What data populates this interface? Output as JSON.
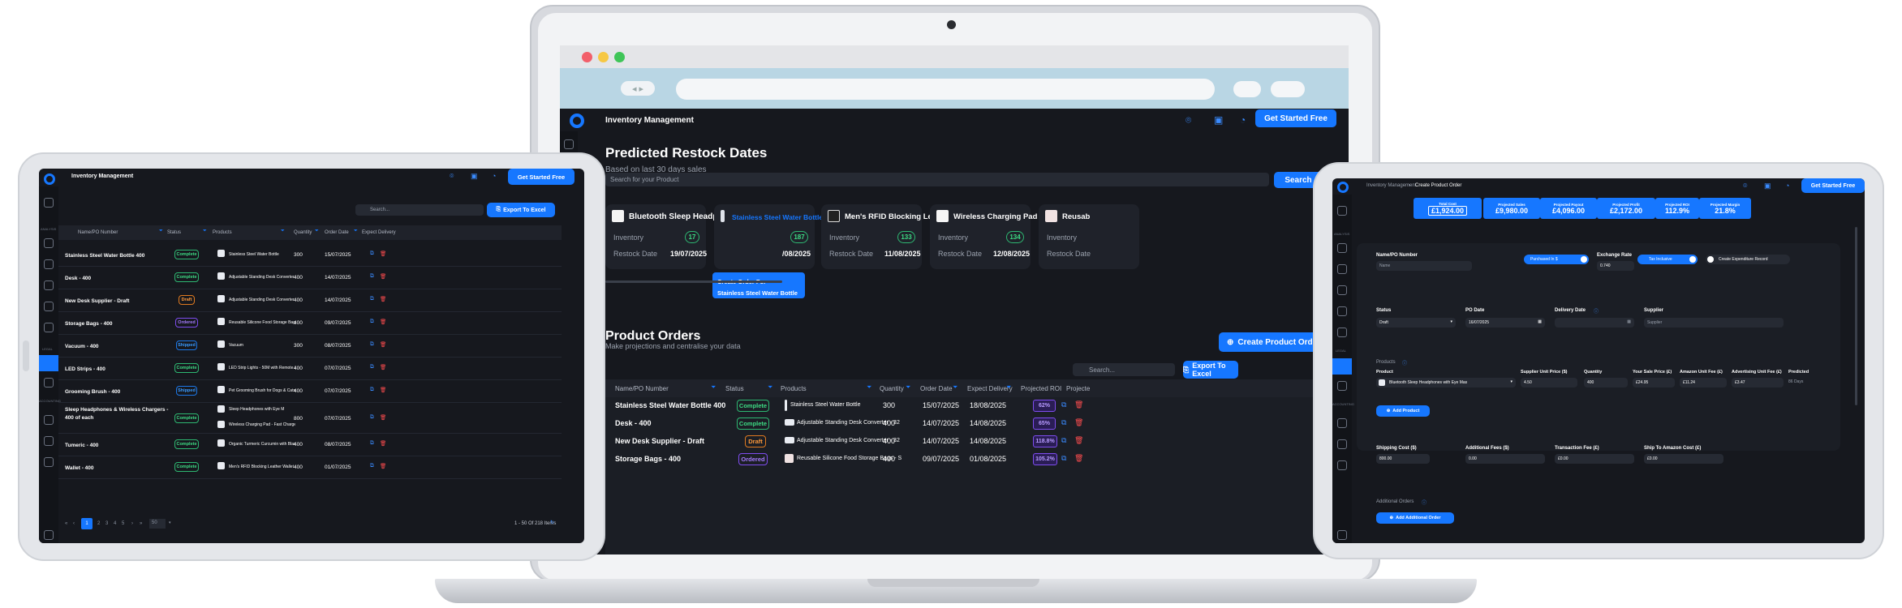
{
  "app_title": "Inventory Management",
  "header_button": "Get Started Free",
  "restock": {
    "title": "Predicted Restock Dates",
    "subtitle": "Based on last 30 days sales",
    "search_placeholder": "Search for your Product",
    "search_button": "Search",
    "inventory_label": "Inventory",
    "restock_label": "Restock Date",
    "cards": [
      {
        "name": "Bluetooth Sleep Headpho...",
        "inventory": "17",
        "date": "19/07/2025"
      },
      {
        "name": "Stainless Steel Water Bottle",
        "inventory": "187",
        "date": "/08/2025"
      },
      {
        "name": "Men's RFID Blocking Leat...",
        "inventory": "133",
        "date": "11/08/2025"
      },
      {
        "name": "Wireless Charging Pad - F...",
        "inventory": "134",
        "date": "12/08/2025"
      },
      {
        "name": "Reusab",
        "inventory": "",
        "date": ""
      }
    ],
    "tooltip_line1": "Create Order For",
    "tooltip_line2": "Stainless Steel Water Bottle"
  },
  "orders": {
    "title": "Product Orders",
    "subtitle": "Make projections and centralise your data",
    "create_button": "Create Product Order",
    "search_placeholder": "Search...",
    "export_button": "Export To Excel",
    "columns": [
      "Name/PO Number",
      "Status",
      "Products",
      "Quantity",
      "Order Date",
      "Expect Delivery",
      "Projected ROI",
      "Projecte"
    ],
    "rows": [
      {
        "name": "Stainless Steel Water Bottle 400",
        "status": "Complete",
        "product": "Stainless Steel Water Bottle",
        "qty": "300",
        "order": "15/07/2025",
        "delivery": "18/08/2025",
        "roi": "62%"
      },
      {
        "name": "Desk - 400",
        "status": "Complete",
        "product": "Adjustable Standing Desk Converter - 32",
        "qty": "400",
        "order": "14/07/2025",
        "delivery": "14/08/2025",
        "roi": "65%"
      },
      {
        "name": "New Desk Supplier - Draft",
        "status": "Draft",
        "product": "Adjustable Standing Desk Converter - 32",
        "qty": "400",
        "order": "14/07/2025",
        "delivery": "14/08/2025",
        "roi": "118.8%"
      },
      {
        "name": "Storage Bags - 400",
        "status": "Ordered",
        "product": "Reusable Silicone Food Storage Bags - S",
        "qty": "400",
        "order": "09/07/2025",
        "delivery": "01/08/2025",
        "roi": "105.2%"
      }
    ]
  },
  "tablet_left": {
    "search_placeholder": "Search...",
    "export_button": "Export To Excel",
    "columns": [
      "Name/PO Number",
      "Status",
      "Products",
      "Quantity",
      "Order Date",
      "Expect Delivery"
    ],
    "rows": [
      {
        "name": "Stainless Steel Water Bottle 400",
        "status": "Complete",
        "product": "Stainless Steel Water Bottle",
        "qty": "300",
        "date": "15/07/2025"
      },
      {
        "name": "Desk - 400",
        "status": "Complete",
        "product": "Adjustable Standing Desk Converter - 32",
        "qty": "400",
        "date": "14/07/2025"
      },
      {
        "name": "New Desk Supplier - Draft",
        "status": "Draft",
        "product": "Adjustable Standing Desk Converter - 32",
        "qty": "400",
        "date": "14/07/2025"
      },
      {
        "name": "Storage Bags - 400",
        "status": "Ordered",
        "product": "Reusable Silicone Food Storage Bags - S",
        "qty": "400",
        "date": "09/07/2025"
      },
      {
        "name": "Vacuum - 400",
        "status": "Shipped",
        "product": "Vacuum",
        "qty": "300",
        "date": "08/07/2025"
      },
      {
        "name": "LED Strips - 400",
        "status": "Complete",
        "product": "LED Strip Lights - 50M with Remote & Ap",
        "qty": "400",
        "date": "07/07/2025"
      },
      {
        "name": "Grooming Brush - 400",
        "status": "Shipped",
        "product": "Pet Grooming Brush for Dogs & Cats - De",
        "qty": "400",
        "date": "07/07/2025"
      },
      {
        "name": "Sleep Headphones & Wireless Chargers - 400 of each",
        "status": "Complete",
        "product": "Sleep Headphones with Eye M",
        "product2": "Wireless Charging Pad - Fast Charge 15V",
        "qty": "800",
        "date": "07/07/2025"
      },
      {
        "name": "Tumeric - 400",
        "status": "Complete",
        "product": "Organic Turmeric Curcumin with Black P",
        "qty": "400",
        "date": "08/07/2025"
      },
      {
        "name": "Wallet - 400",
        "status": "Complete",
        "product": "Men's RFID Blocking Leather Wallet - Slim",
        "qty": "400",
        "date": "01/07/2025"
      }
    ],
    "pagination": [
      "1",
      "2",
      "3",
      "4",
      "5"
    ],
    "page_size": "50",
    "range_text": "1 - 50 Of 218 Items"
  },
  "tablet_right": {
    "breadcrumb_parent": "Inventory Management",
    "breadcrumb_current": "Create Product Order",
    "stats": [
      {
        "label": "Total Cost",
        "value": "£1,924.00"
      },
      {
        "label": "Projected Sales",
        "value": "£9,980.00"
      },
      {
        "label": "Projected Payout",
        "value": "£4,096.00"
      },
      {
        "label": "Projected Profit",
        "value": "£2,172.00"
      },
      {
        "label": "Projected ROI",
        "value": "112.9%"
      },
      {
        "label": "Projected Margin",
        "value": "21.8%"
      }
    ],
    "name_label": "Name/PO Number",
    "name_placeholder": "Name",
    "purchased_toggle": "Purchased In $",
    "exchange_label": "Exchange Rate",
    "exchange_value": "0.740",
    "tax_toggle": "Tax Inclusive",
    "expenditure_toggle": "Create Expenditure Record",
    "status_label": "Status",
    "status_value": "Draft",
    "po_date_label": "PO Date",
    "po_date_value": "16/07/2025",
    "delivery_label": "Delivery Date",
    "supplier_label": "Supplier",
    "supplier_placeholder": "Supplier",
    "products_label": "Products",
    "product_col": "Product",
    "supplier_price_col": "Supplier Unit Price ($)",
    "quantity_col": "Quantity",
    "sale_price_col": "Your Sale Price (£)",
    "amazon_fee_col": "Amazon Unit Fee (£)",
    "ad_fee_col": "Advertising Unit Fee (£)",
    "predicted_col": "Predicted",
    "product_value": "Bluetooth Sleep Headphones with Eye Mas",
    "supplier_price_value": "4.50",
    "quantity_value": "400",
    "sale_price_value": "£24.95",
    "amazon_fee_value": "£11.24",
    "ad_fee_value": "£3.47",
    "predicted_value": "86 Days",
    "add_product": "Add Product",
    "shipping_label": "Shipping Cost ($)",
    "shipping_value": "800.00",
    "additional_fees_label": "Additional Fees ($)",
    "additional_fees_value": "0.00",
    "transaction_label": "Transaction Fee (£)",
    "transaction_value": "£0.00",
    "ship_amazon_label": "Ship To Amazon Cost (£)",
    "ship_amazon_value": "£0.00",
    "additional_orders_label": "Additional Orders",
    "add_additional_order": "Add Additional Order"
  },
  "sidebar_small_labels": [
    "ANALYSIS",
    "LEGAL",
    "ACCOUNTING"
  ],
  "colors": {
    "accent": "#1677ff",
    "bg": "#16181e",
    "card": "#1f222a",
    "complete": "#3ddc84",
    "draft": "#ff9a3c",
    "ordered": "#a67bff",
    "shipped": "#3a9bff"
  }
}
